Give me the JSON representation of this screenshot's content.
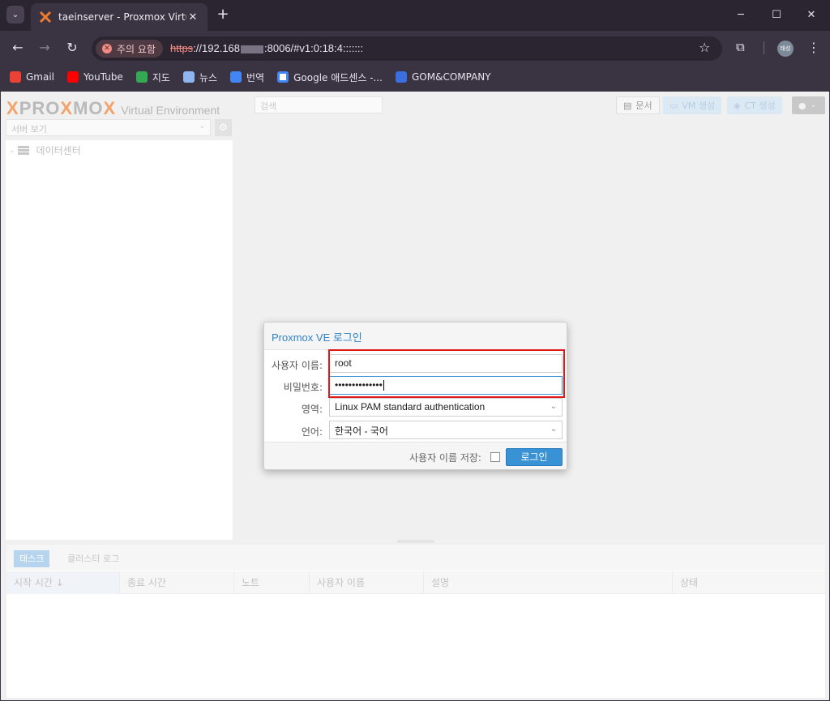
{
  "browser": {
    "tab_title": "taeinserver - Proxmox Virtual E",
    "security_chip": "주의 요함",
    "url_scheme": "https",
    "url_host_prefix": "://192.168",
    "url_rest": ":8006/#v1:0:18:4:::::::",
    "profile_initials": "태성"
  },
  "bookmarks": [
    {
      "label": "Gmail",
      "color": "#ea4335"
    },
    {
      "label": "YouTube",
      "color": "#ff0000"
    },
    {
      "label": "지도",
      "color": "#34a853"
    },
    {
      "label": "뉴스",
      "color": "#4285f4"
    },
    {
      "label": "번역",
      "color": "#4285f4"
    },
    {
      "label": "Google 애드센스 -...",
      "color": "#fbbc04"
    },
    {
      "label": "GOM&COMPANY",
      "color": "#3b6fe0"
    }
  ],
  "proxmox": {
    "logo_text_1": "PRO",
    "logo_x": "X",
    "logo_text_2": "MO",
    "logo_text_3": "X",
    "logo_subtitle": "Virtual Environment",
    "search_placeholder": "검색",
    "docs_label": "문서",
    "create_vm_label": "VM 생성",
    "create_ct_label": "CT 생성",
    "view_select": "서버 보기",
    "tree_root": "데이터센터"
  },
  "bottom_panel": {
    "tabs": [
      "태스크",
      "클러스터 로그"
    ],
    "columns": [
      "시작 시간 ↓",
      "종료 시간",
      "노트",
      "사용자 이름",
      "설명",
      "상태"
    ]
  },
  "login_dialog": {
    "title": "Proxmox VE 로그인",
    "username_label": "사용자 이름:",
    "username_value": "root",
    "password_label": "비밀번호:",
    "password_value": "••••••••••••••",
    "realm_label": "영역:",
    "realm_value": "Linux PAM standard authentication",
    "language_label": "언어:",
    "language_value": "한국어 - 국어",
    "remember_label": "사용자 이름 저장:",
    "remember_checked": false,
    "login_button": "로그인"
  },
  "colors": {
    "accent": "#3892d4",
    "highlight_box": "#e01818",
    "proxmox_orange": "#f3a26b"
  }
}
